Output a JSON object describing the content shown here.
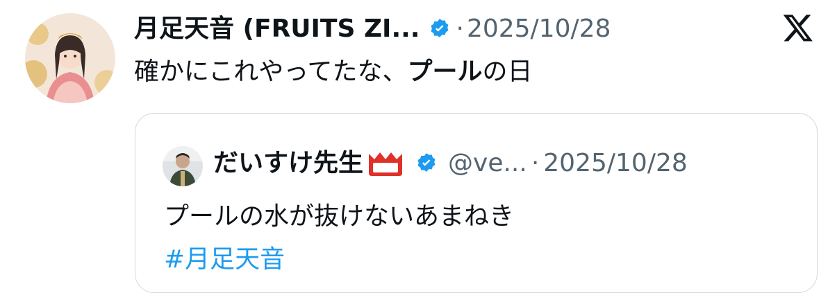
{
  "tweet": {
    "author_name": "月足天音 (FRUITS ZI...",
    "separator": "·",
    "date": "2025/10/28",
    "text_part1": "確かにこれやってたな、",
    "text_bold": "プール",
    "text_part2": "の日"
  },
  "quote": {
    "author_name": "だいすけ先生",
    "handle": "@ve...",
    "separator": "·",
    "date": "2025/10/28",
    "text": "プールの水が抜けないあまねき",
    "hashtag": "#月足天音"
  },
  "icons": {
    "verified": "verified-badge-icon",
    "platform_logo": "x-logo-icon",
    "name_emoji": "new-button-emoji-icon"
  },
  "colors": {
    "verified": "#1d9bf0",
    "hashtag": "#1d9bf0",
    "secondary_text": "#536471",
    "border": "#cfd9de",
    "emoji_red": "#e0302a"
  }
}
